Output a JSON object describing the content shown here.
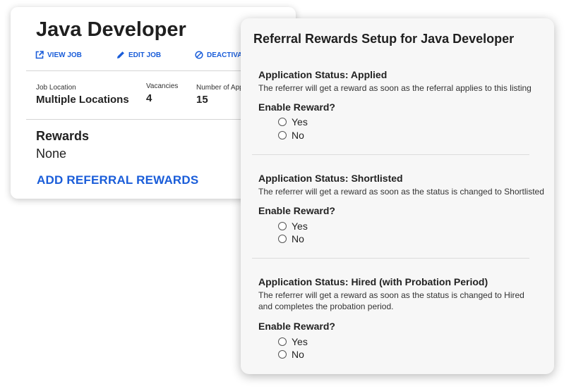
{
  "job_card": {
    "title": "Java Developer",
    "actions": {
      "view_job": "VIEW JOB",
      "edit_job": "EDIT JOB",
      "deactivate": "DEACTIVAT"
    },
    "stats": {
      "location_label": "Job Location",
      "location_value": "Multiple Locations",
      "vacancies_label": "Vacancies",
      "vacancies_value": "4",
      "applicants_label": "Number of App",
      "applicants_value": "15"
    },
    "rewards_heading": "Rewards",
    "rewards_value": "None",
    "add_rewards_link": "ADD REFERRAL REWARDS",
    "link_color": "#1a5dd9"
  },
  "modal": {
    "title": "Referral Rewards Setup for Java Developer",
    "enable_label": "Enable Reward?",
    "yes_label": "Yes",
    "no_label": "No",
    "sections": [
      {
        "status": "Application Status: Applied",
        "description": "The referrer will get a reward as soon as the referral applies to this listing"
      },
      {
        "status": "Application Status: Shortlisted",
        "description": "The referrer will get a reward as soon as the status is changed to Shortlisted"
      },
      {
        "status": "Application Status: Hired (with Probation Period)",
        "description": "The referrer will get a reward as soon as the status is changed to Hired and completes the probation period."
      }
    ]
  }
}
